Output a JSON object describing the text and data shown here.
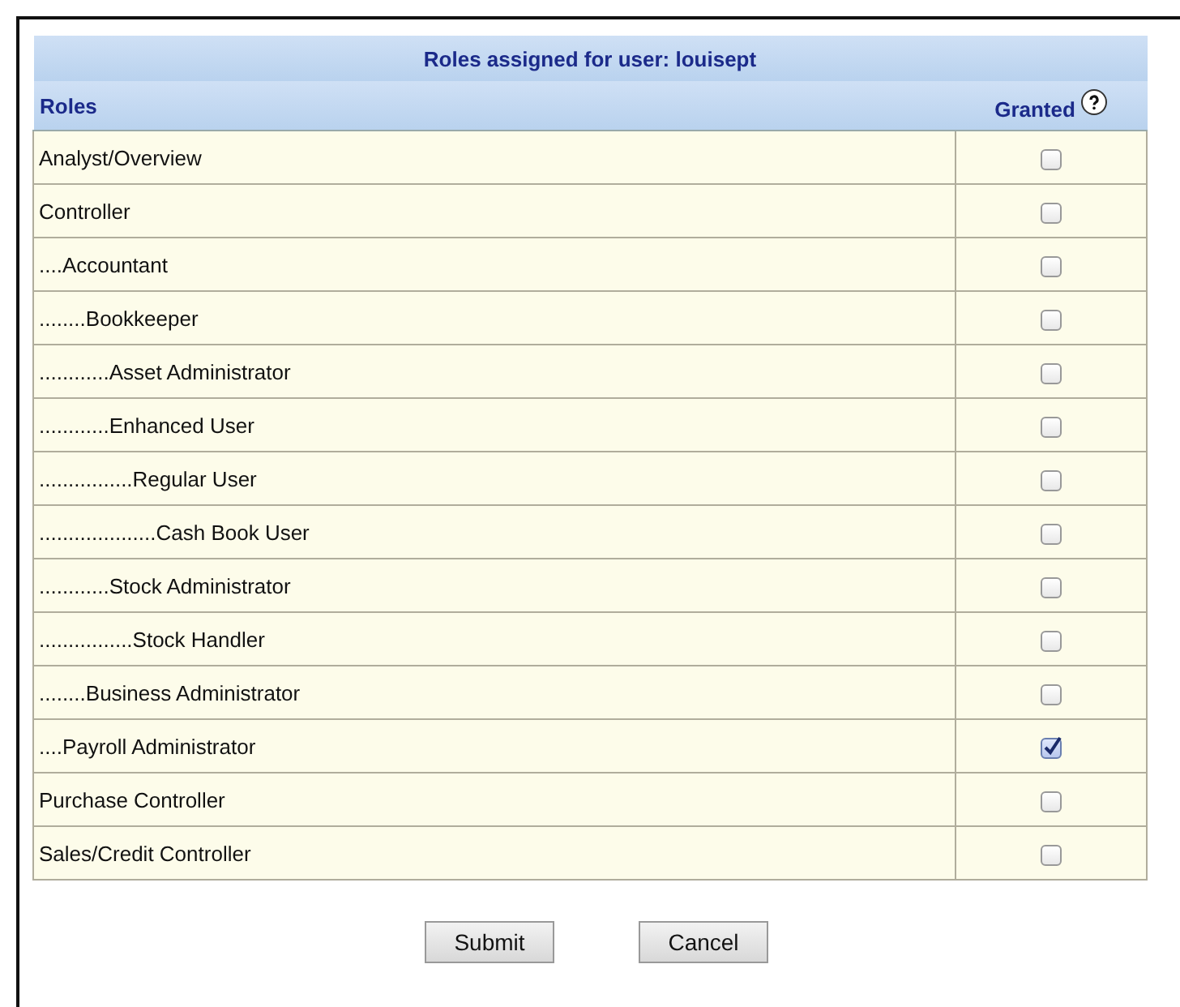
{
  "table": {
    "title": "Roles assigned for user: louisept",
    "columns": [
      "Roles",
      "Granted"
    ],
    "rows": [
      {
        "role": "Analyst/Overview",
        "granted": false
      },
      {
        "role": "Controller",
        "granted": false
      },
      {
        "role": "....Accountant",
        "granted": false
      },
      {
        "role": "........Bookkeeper",
        "granted": false
      },
      {
        "role": "............Asset Administrator",
        "granted": false
      },
      {
        "role": "............Enhanced User",
        "granted": false
      },
      {
        "role": "................Regular User",
        "granted": false
      },
      {
        "role": "....................Cash Book User",
        "granted": false
      },
      {
        "role": "............Stock Administrator",
        "granted": false
      },
      {
        "role": "................Stock Handler",
        "granted": false
      },
      {
        "role": "........Business Administrator",
        "granted": false
      },
      {
        "role": "....Payroll Administrator",
        "granted": true
      },
      {
        "role": "Purchase Controller",
        "granted": false
      },
      {
        "role": "Sales/Credit Controller",
        "granted": false
      }
    ]
  },
  "buttons": [
    "Submit",
    "Cancel"
  ]
}
